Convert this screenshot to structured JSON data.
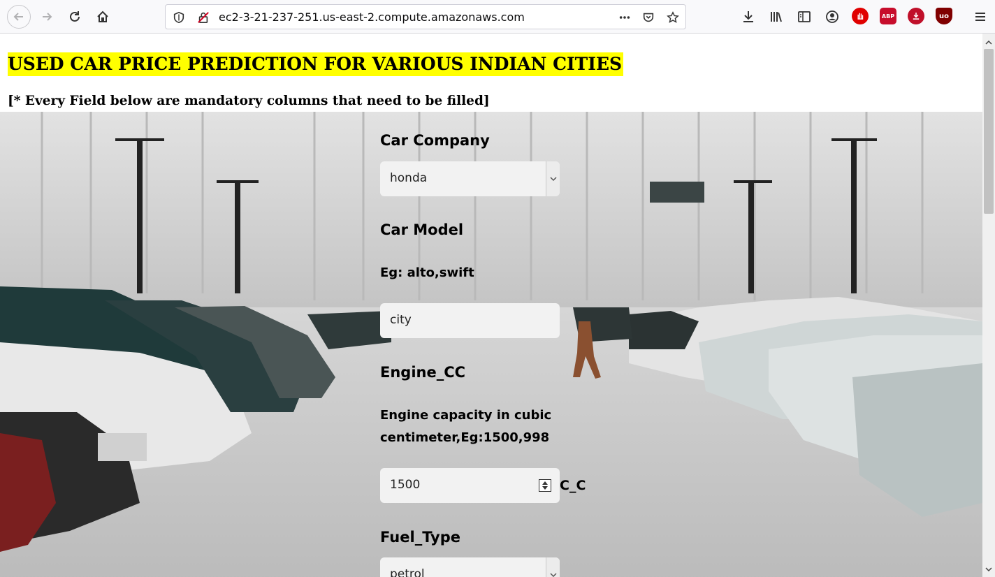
{
  "browser": {
    "url": "ec2-3-21-237-251.us-east-2.compute.amazonaws.com",
    "extensions": {
      "abp_label": "ABP",
      "ublock_label": "uo"
    }
  },
  "page": {
    "title": "USED CAR PRICE PREDICTION FOR VARIOUS INDIAN CITIES",
    "note": "[* Every Field below are mandatory columns that need to be filled]",
    "form": {
      "car_company": {
        "label": "Car Company",
        "value": "honda"
      },
      "car_model": {
        "label": "Car Model",
        "hint": "Eg: alto,swift",
        "value": "city"
      },
      "engine_cc": {
        "label": "Engine_CC",
        "hint_line1": "Engine capacity in cubic",
        "hint_line2": "centimeter,Eg:1500,998",
        "value": "1500",
        "unit": "C_C"
      },
      "fuel_type": {
        "label": "Fuel_Type",
        "value": "petrol"
      }
    }
  }
}
